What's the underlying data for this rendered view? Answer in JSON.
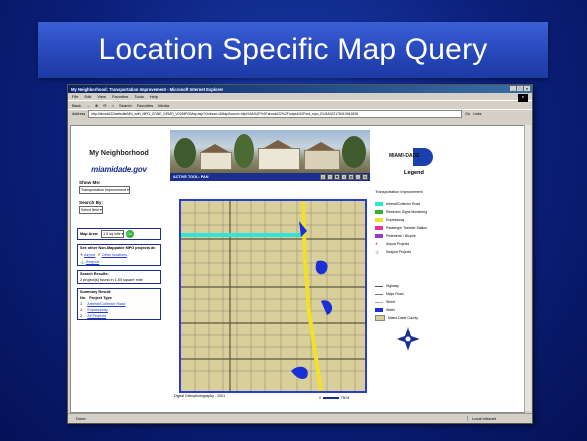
{
  "slide": {
    "title": "Location Specific Map Query"
  },
  "window": {
    "title": "My Neighborhood: Transportation Improvement - Microsoft Internet Explorer",
    "controls": [
      "_",
      "□",
      "×"
    ],
    "menu": [
      "File",
      "Edit",
      "View",
      "Favorites",
      "Tools",
      "Help"
    ],
    "toolbar": [
      "Back",
      "→",
      "Search",
      "Favorites",
      "Media"
    ],
    "address_label": "Address",
    "address_url": "http://ahora022/website/MN_with_MPO_ZONE_DEMO_V02/MPOMap.asp?Ordnum=&MapSource=http%3A%2F%2Fahora022%2Foutput%2Fmd_mpo_ELMA022178410941838",
    "go_label": "Go",
    "links_label": "Links",
    "status_left": "Done",
    "status_right": "Local intranet"
  },
  "left_panel": {
    "title": "My Neighborhood",
    "logo": "miamidade.gov",
    "show_me_label": "Show Me:",
    "show_me_value": "Transportation Improvement",
    "search_by_label": "Search By:",
    "search_by_value": "Select Item",
    "map_area_label": "Map Area:",
    "map_area_value": "1.5 sq mile",
    "go_label": "Go",
    "other_header": "See other Non-Mappable MPO projects at:",
    "airport": "Airport",
    "other_locations": "Other locations",
    "seaport": "Seaport",
    "results_header": "Search Results:",
    "results_text": "2 project(s) found in 1.50 square mile",
    "summary_header": "Summary Result:",
    "summary_cols": [
      "No.",
      "Project Type"
    ],
    "summary_rows": [
      {
        "no": "1",
        "type": "Arterial/Collector Road"
      },
      {
        "no": "1",
        "type": "Expressway"
      },
      {
        "no": "2",
        "type": "All Projects"
      }
    ]
  },
  "header": {
    "active_tool": "ACTIVE TOOL: PAN"
  },
  "map": {
    "caption": "Digital Orthophotography - 2001",
    "scale_left": "0",
    "scale_right": "750 ft",
    "colors": {
      "roads_land": "#d8cf9a",
      "arterial": "#2ee6d8",
      "expressway": "#f2e02a",
      "water": "#1a2fd6"
    }
  },
  "right_panel": {
    "badge": "MIAMI-DADE",
    "legend_title": "Legend",
    "legend_sub": "Transportation Improvement",
    "items": [
      {
        "label": "Arterial/Collector Road",
        "color": "#2ee6d8"
      },
      {
        "label": "Electronic Signs Monitoring",
        "color": "#2fb52f"
      },
      {
        "label": "Expressway",
        "color": "#f2e02a"
      },
      {
        "label": "Passenger Transfer Station",
        "color": "#e0369a"
      },
      {
        "label": "Pedestrian / Bicycle",
        "color": "#8a3fc8"
      },
      {
        "label": "Airport Projects",
        "color": "#b01a1a"
      },
      {
        "label": "Seaport Projects",
        "color": "#1a2fd6"
      }
    ],
    "base_items": [
      {
        "label": "Highway",
        "color": "#555555"
      },
      {
        "label": "Major Road",
        "color": "#777777"
      },
      {
        "label": "Street",
        "color": "#aaaaaa"
      },
      {
        "label": "Water",
        "color": "#1a2fd6"
      },
      {
        "label": "Miami-Dade County",
        "color": "#d8cf9a"
      }
    ],
    "compass": {
      "n": "N",
      "s": "S",
      "e": "E",
      "w": "W"
    }
  }
}
